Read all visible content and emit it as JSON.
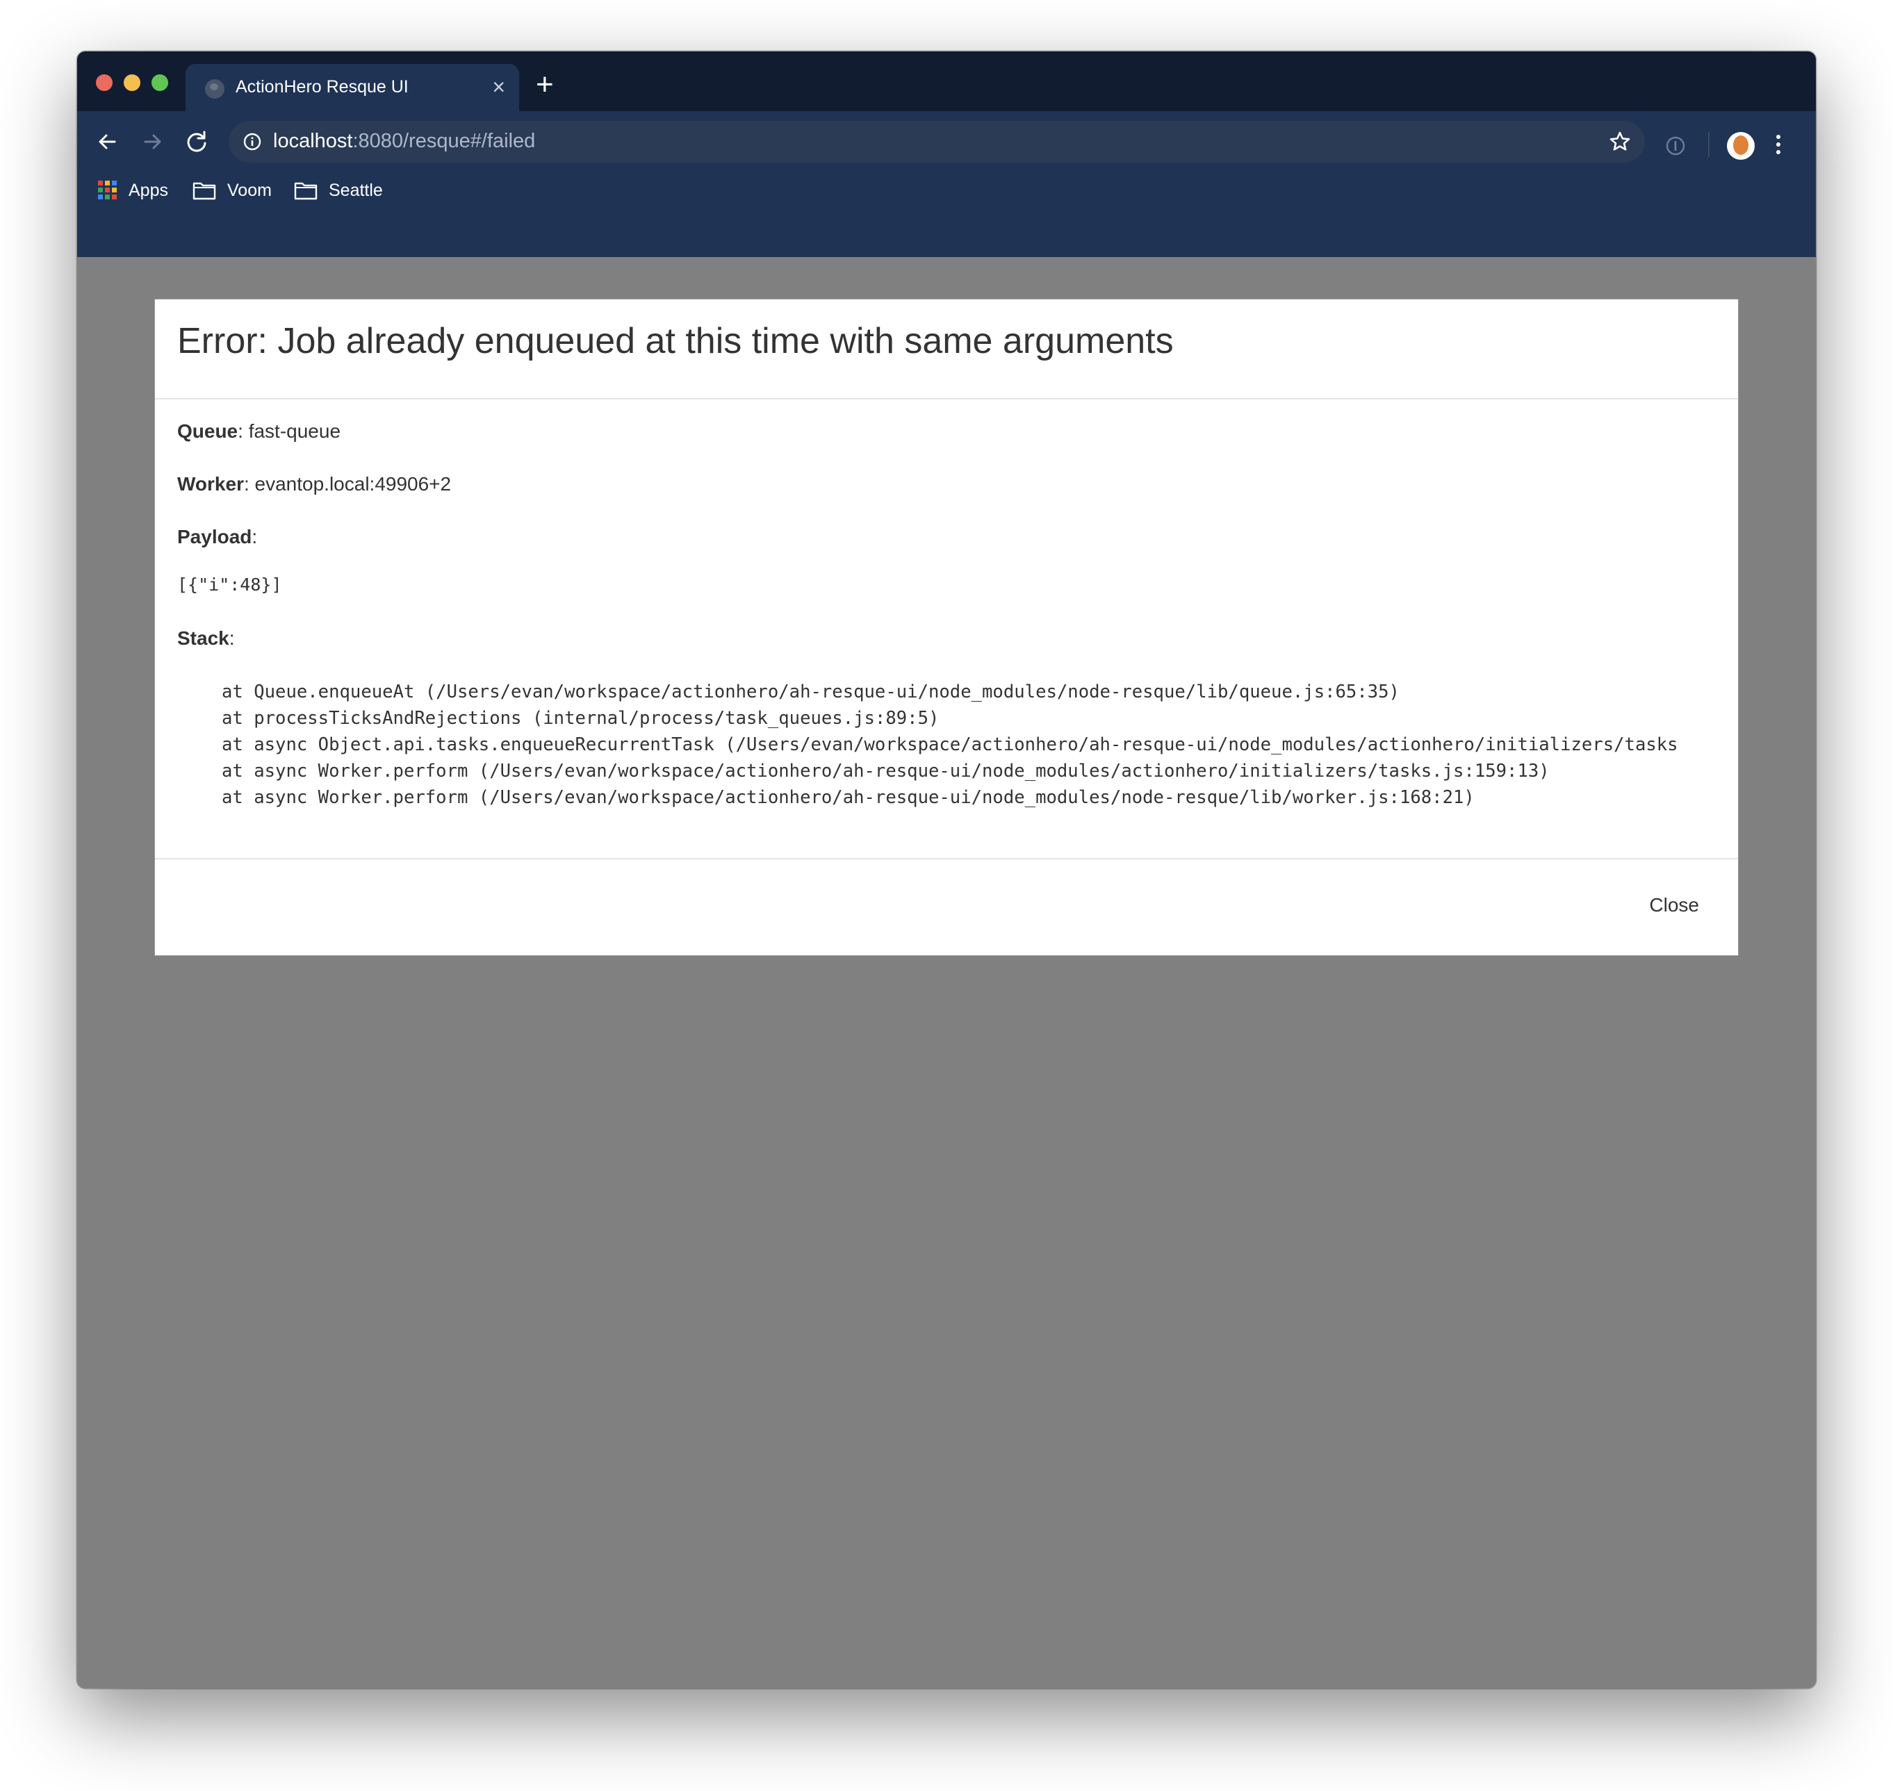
{
  "browser": {
    "tab_title": "ActionHero Resque UI",
    "tab_close": "×",
    "new_tab": "+",
    "url_host": "localhost",
    "url_path": ":8080/resque#/failed",
    "bookmarks": [
      {
        "label": "Apps",
        "icon": "apps-grid-icon"
      },
      {
        "label": "Voom",
        "icon": "folder-icon"
      },
      {
        "label": "Seattle",
        "icon": "folder-icon"
      }
    ],
    "colors": {
      "tab_strip": "#111c31",
      "toolbar": "#1f3355",
      "omnibox": "#2b3a55"
    }
  },
  "modal": {
    "title": "Error: Job already enqueued at this time with same arguments",
    "queue_label": "Queue",
    "queue_value": "fast-queue",
    "worker_label": "Worker",
    "worker_value": "evantop.local:49906+2",
    "payload_label": "Payload",
    "payload_value": "[{\"i\":48}]",
    "stack_label": "Stack",
    "separator": ":",
    "stack_lines": [
      "at Queue.enqueueAt (/Users/evan/workspace/actionhero/ah-resque-ui/node_modules/node-resque/lib/queue.js:65:35)",
      "at processTicksAndRejections (internal/process/task_queues.js:89:5)",
      "at async Object.api.tasks.enqueueRecurrentTask (/Users/evan/workspace/actionhero/ah-resque-ui/node_modules/actionhero/initializers/tasks",
      "at async Worker.perform (/Users/evan/workspace/actionhero/ah-resque-ui/node_modules/actionhero/initializers/tasks.js:159:13)",
      "at async Worker.perform (/Users/evan/workspace/actionhero/ah-resque-ui/node_modules/node-resque/lib/worker.js:168:21)"
    ],
    "close_label": "Close"
  },
  "backdrop_color": "#808080"
}
